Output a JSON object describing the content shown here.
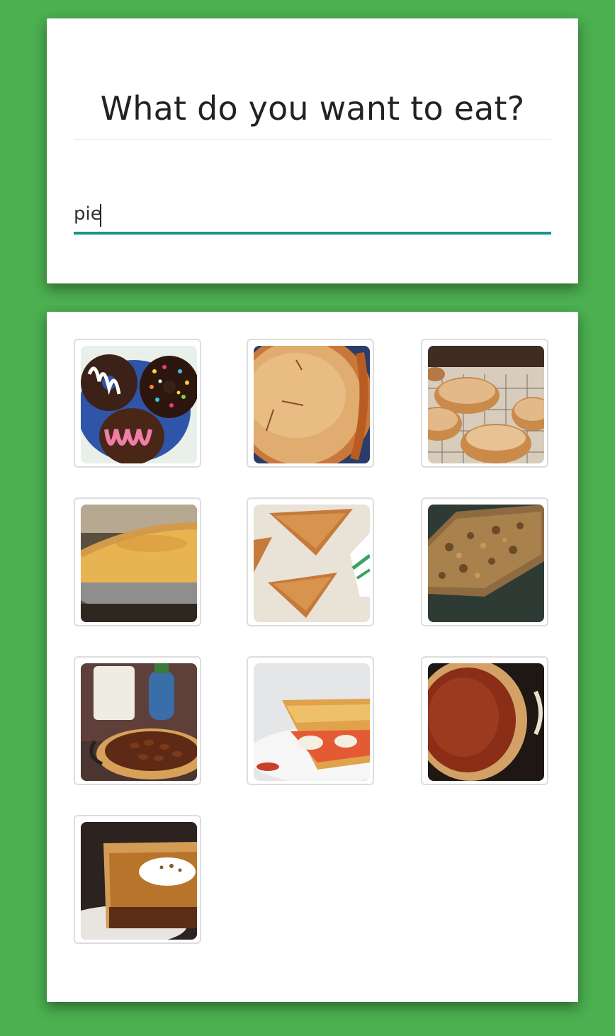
{
  "search": {
    "title": "What do you want to eat?",
    "query": "pie",
    "accent_color": "#16978a"
  },
  "background_color": "#4caf50",
  "results": [
    {
      "name": "donuts-image",
      "icon": "donuts"
    },
    {
      "name": "fruit-pie-image",
      "icon": "double-crust-pie"
    },
    {
      "name": "mini-pies-image",
      "icon": "mini-pies-on-rack"
    },
    {
      "name": "custard-pie-image",
      "icon": "custard-pie"
    },
    {
      "name": "hand-pies-image",
      "icon": "hand-pies"
    },
    {
      "name": "meat-pie-image",
      "icon": "meat-pie-slice"
    },
    {
      "name": "pecan-pie-image",
      "icon": "pecan-pie"
    },
    {
      "name": "tomato-pie-image",
      "icon": "tomato-pie-slice"
    },
    {
      "name": "sweet-potato-pie-image",
      "icon": "sweet-potato-pie"
    },
    {
      "name": "pumpkin-pie-image",
      "icon": "pumpkin-pie-slice"
    }
  ]
}
